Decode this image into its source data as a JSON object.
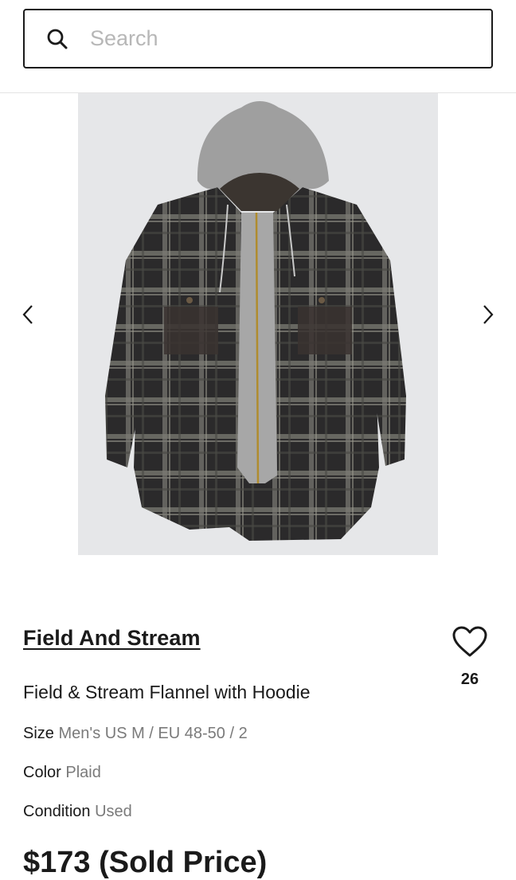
{
  "search": {
    "placeholder": "Search"
  },
  "icons": {
    "search": "search-icon",
    "prev": "chevron-left-icon",
    "next": "chevron-right-icon",
    "like": "heart-outline-icon"
  },
  "product": {
    "brand": "Field And Stream",
    "title": "Field & Stream Flannel with Hoodie",
    "likes": "26",
    "attributes": [
      {
        "label": "Size",
        "value": "Men's US M / EU 48-50 / 2"
      },
      {
        "label": "Color",
        "value": "Plaid"
      },
      {
        "label": "Condition",
        "value": "Used"
      }
    ],
    "price": "$173 (Sold Price)"
  },
  "colors": {
    "text": "#1a1a1a",
    "muted": "#7a7a7a",
    "placeholder": "#b7b7b7",
    "divider": "#e4e4e4"
  }
}
